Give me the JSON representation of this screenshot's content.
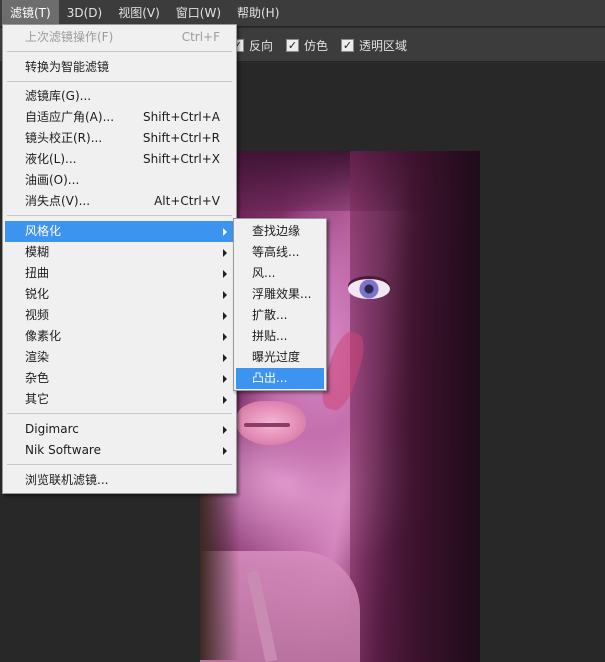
{
  "menubar": {
    "items": [
      {
        "label": "滤镜(T)",
        "active": true
      },
      {
        "label": "3D(D)"
      },
      {
        "label": "视图(V)"
      },
      {
        "label": "窗口(W)"
      },
      {
        "label": "帮助(H)"
      }
    ]
  },
  "options": {
    "checkboxes": [
      {
        "label": "反向",
        "checked": true
      },
      {
        "label": "仿色",
        "checked": true
      },
      {
        "label": "透明区域",
        "checked": true
      }
    ],
    "check_glyph": "✓"
  },
  "filter_menu": {
    "items": [
      {
        "label": "上次滤镜操作(F)",
        "shortcut": "Ctrl+F",
        "disabled": true
      },
      {
        "label": "转换为智能滤镜"
      },
      {
        "label": "滤镜库(G)..."
      },
      {
        "label": "自适应广角(A)...",
        "shortcut": "Shift+Ctrl+A"
      },
      {
        "label": "镜头校正(R)...",
        "shortcut": "Shift+Ctrl+R"
      },
      {
        "label": "液化(L)...",
        "shortcut": "Shift+Ctrl+X"
      },
      {
        "label": "油画(O)..."
      },
      {
        "label": "消失点(V)...",
        "shortcut": "Alt+Ctrl+V"
      },
      {
        "label": "风格化",
        "submenu": true,
        "highlight": true
      },
      {
        "label": "模糊",
        "submenu": true
      },
      {
        "label": "扭曲",
        "submenu": true
      },
      {
        "label": "锐化",
        "submenu": true
      },
      {
        "label": "视频",
        "submenu": true
      },
      {
        "label": "像素化",
        "submenu": true
      },
      {
        "label": "渲染",
        "submenu": true
      },
      {
        "label": "杂色",
        "submenu": true
      },
      {
        "label": "其它",
        "submenu": true
      },
      {
        "label": "Digimarc",
        "submenu": true
      },
      {
        "label": "Nik Software",
        "submenu": true
      },
      {
        "label": "浏览联机滤镜..."
      }
    ]
  },
  "stylize_menu": {
    "items": [
      {
        "label": "查找边缘"
      },
      {
        "label": "等高线..."
      },
      {
        "label": "风..."
      },
      {
        "label": "浮雕效果..."
      },
      {
        "label": "扩散..."
      },
      {
        "label": "拼贴..."
      },
      {
        "label": "曝光过度"
      },
      {
        "label": "凸出...",
        "highlight": true
      }
    ]
  },
  "colors": {
    "menu_bg": "#f0f0f0",
    "highlight": "#3c93f0",
    "app_bar": "#3c3c3c",
    "workspace": "#282828"
  }
}
